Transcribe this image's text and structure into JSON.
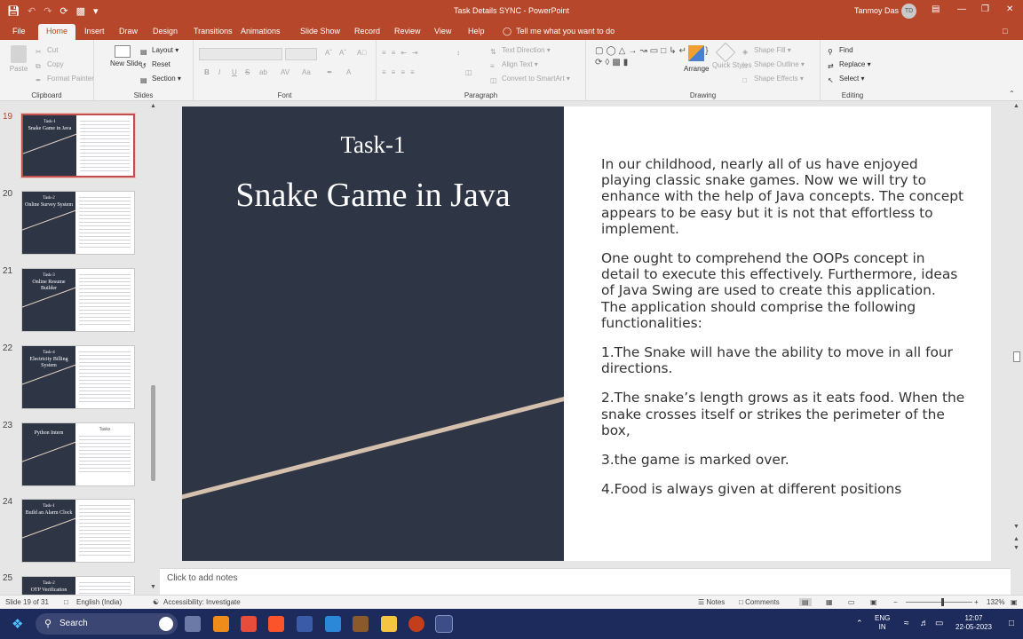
{
  "window": {
    "title": "Task Details SYNC  -  PowerPoint",
    "user_name": "Tanmoy Das",
    "user_initials": "TD"
  },
  "tabs": [
    "File",
    "Home",
    "Insert",
    "Draw",
    "Design",
    "Transitions",
    "Animations",
    "Slide Show",
    "Record",
    "Review",
    "View",
    "Help"
  ],
  "active_tab": "Home",
  "tell_me": "Tell me what you want to do",
  "ribbon": {
    "clipboard": {
      "paste": "Paste",
      "cut": "Cut",
      "copy": "Copy",
      "format_painter": "Format Painter",
      "label": "Clipboard"
    },
    "slides": {
      "new_slide": "New Slide",
      "layout": "Layout",
      "reset": "Reset",
      "section": "Section",
      "label": "Slides"
    },
    "font": {
      "bold": "B",
      "italic": "I",
      "underline": "U",
      "strike": "S",
      "shadow": "ab",
      "spacing": "AV",
      "case": "Aa",
      "label": "Font"
    },
    "paragraph": {
      "text_direction": "Text Direction",
      "align_text": "Align Text",
      "convert_smartart": "Convert to SmartArt",
      "label": "Paragraph"
    },
    "drawing": {
      "arrange": "Arrange",
      "quick_styles": "Quick Styles",
      "shape_fill": "Shape Fill",
      "shape_outline": "Shape Outline",
      "shape_effects": "Shape Effects",
      "label": "Drawing"
    },
    "editing": {
      "find": "Find",
      "replace": "Replace",
      "select": "Select",
      "label": "Editing"
    }
  },
  "thumbnails": [
    {
      "num": "19",
      "title": "Task-1",
      "subtitle": "Snake Game in Java",
      "selected": true
    },
    {
      "num": "20",
      "title": "Task-2",
      "subtitle": "Online Survey System",
      "selected": false
    },
    {
      "num": "21",
      "title": "Task-3",
      "subtitle": "Online Resume Builder",
      "selected": false
    },
    {
      "num": "22",
      "title": "Task-4",
      "subtitle": "Electricity Billing System",
      "selected": false
    },
    {
      "num": "23",
      "title": "",
      "subtitle": "Python Intern",
      "table": "Tasks",
      "selected": false
    },
    {
      "num": "24",
      "title": "Task-1",
      "subtitle": "Build an Alarm Clock",
      "selected": false
    },
    {
      "num": "25",
      "title": "Task-2",
      "subtitle": "OTP Verification",
      "selected": false
    }
  ],
  "slide": {
    "task_label": "Task-1",
    "title": "Snake Game in Java",
    "paragraphs": [
      "In our childhood, nearly all of us have enjoyed playing classic snake games. Now we will try to enhance with the help of Java concepts. The concept appears to be easy but it is not that effortless to implement.",
      "One ought to comprehend the OOPs concept in detail to execute this effectively. Furthermore, ideas of Java Swing are used to create this application. The application should comprise the following functionalities:",
      "1.The Snake will have the ability to move in all four directions.",
      "2.The snake’s length grows as it eats food. When the snake crosses itself or strikes the perimeter of the box,",
      "3.the game is marked over.",
      "4.Food is always given at different positions"
    ]
  },
  "notes_placeholder": "Click to add notes",
  "status": {
    "slide_info": "Slide 19 of 31",
    "language": "English (India)",
    "accessibility": "Accessibility: Investigate",
    "notes": "Notes",
    "comments": "Comments",
    "zoom": "132%",
    "zoom_fraction": 0.55
  },
  "taskbar": {
    "search": "Search",
    "lang_top": "ENG",
    "lang_bottom": "IN",
    "time": "12:07",
    "date": "22-05-2023"
  },
  "colors": {
    "accent": "#b7472a",
    "slide_dark": "#2e3545",
    "diagonal": "#d5c0ae"
  }
}
